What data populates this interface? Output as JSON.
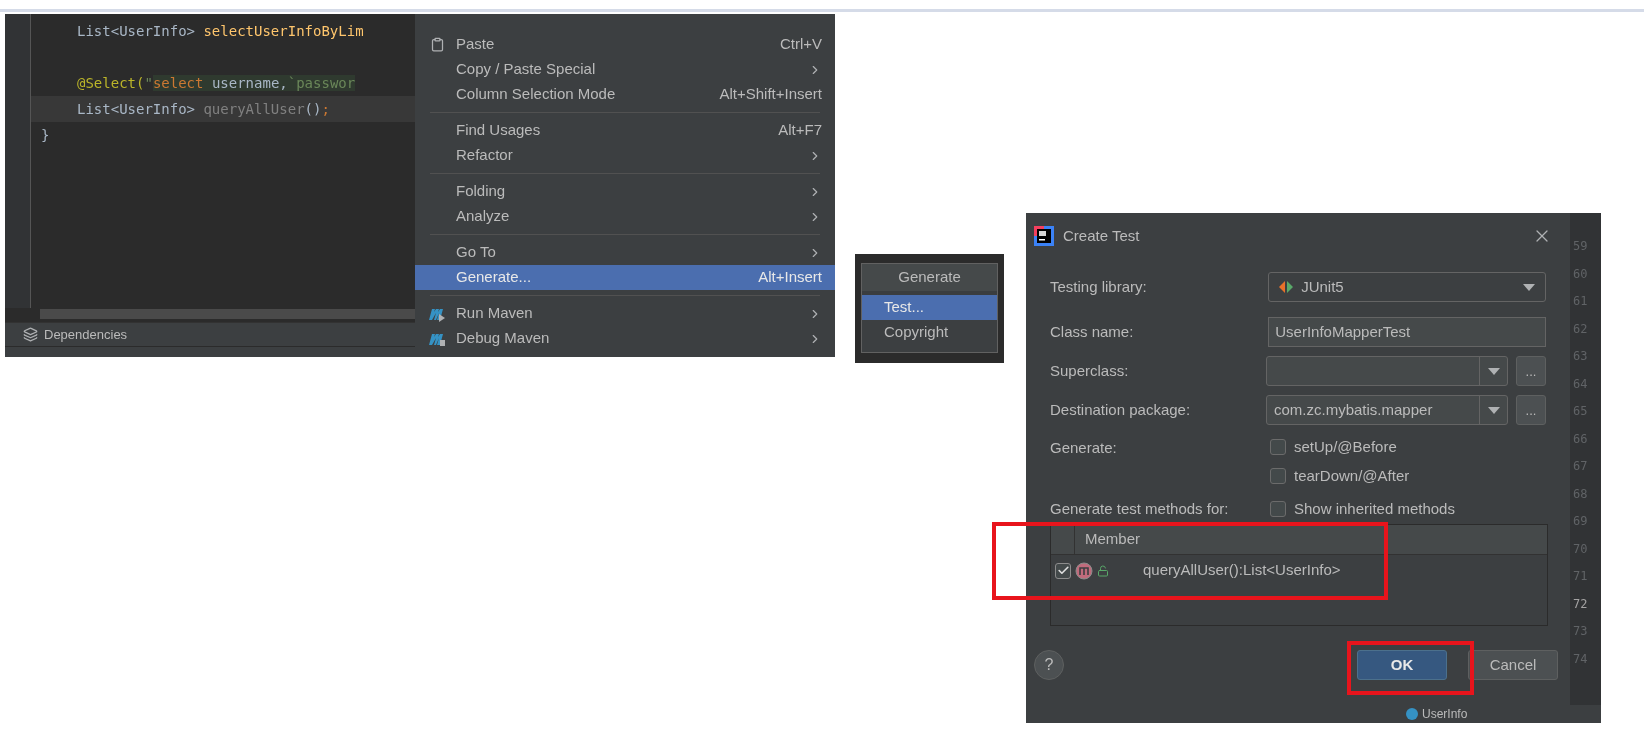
{
  "editor": {
    "lines": [
      {
        "kind": "code",
        "current": false,
        "indent": true,
        "tokens": [
          {
            "kind": "plain",
            "text": "List<UserInfo> "
          },
          {
            "kind": "method",
            "text": "selectUserInfoByLim"
          }
        ]
      },
      {
        "kind": "blank",
        "current": false
      },
      {
        "kind": "code",
        "current": false,
        "indent": true,
        "tokens": [
          {
            "kind": "annotation",
            "text": "@Select("
          },
          {
            "kind": "string",
            "text": "\""
          },
          {
            "kind": "sql_keyword",
            "text": "select"
          },
          {
            "kind": "sql_ident",
            "text": " username,"
          },
          {
            "kind": "sql_quoted",
            "text": "`passwor"
          }
        ]
      },
      {
        "kind": "code",
        "current": true,
        "indent": true,
        "tokens": [
          {
            "kind": "plain",
            "text": "List<UserInfo> "
          },
          {
            "kind": "unused",
            "text": "queryAllUser"
          },
          {
            "kind": "plain",
            "text": "()"
          },
          {
            "kind": "semicolon",
            "text": ";"
          }
        ]
      },
      {
        "kind": "code",
        "current": false,
        "indent": false,
        "tokens": [
          {
            "kind": "plain",
            "text": "}"
          }
        ]
      }
    ],
    "tool_window_tab": "Dependencies"
  },
  "context_menu": {
    "groups": [
      [
        {
          "label": "Paste",
          "shortcut": "Ctrl+V",
          "submenu": false,
          "selected": false
        },
        {
          "label": "Copy / Paste Special",
          "submenu": true,
          "selected": false
        },
        {
          "label": "Column Selection Mode",
          "shortcut": "Alt+Shift+Insert",
          "submenu": false,
          "selected": false
        }
      ],
      [
        {
          "label": "Find Usages",
          "shortcut": "Alt+F7",
          "submenu": false,
          "selected": false
        },
        {
          "label": "Refactor",
          "submenu": true,
          "selected": false
        }
      ],
      [
        {
          "label": "Folding",
          "submenu": true,
          "selected": false
        },
        {
          "label": "Analyze",
          "submenu": true,
          "selected": false
        }
      ],
      [
        {
          "label": "Go To",
          "submenu": true,
          "selected": false
        },
        {
          "label": "Generate...",
          "shortcut": "Alt+Insert",
          "submenu": false,
          "selected": true
        }
      ],
      [
        {
          "label": "Run Maven",
          "submenu": true,
          "selected": false
        },
        {
          "label": "Debug Maven",
          "submenu": true,
          "selected": false
        }
      ]
    ]
  },
  "generate_popup": {
    "title": "Generate",
    "items": [
      {
        "label": "Test...",
        "selected": true
      },
      {
        "label": "Copyright",
        "selected": false
      }
    ]
  },
  "dialog": {
    "title": "Create Test",
    "fields": [
      {
        "kind": "dropdown",
        "label": "Testing library:",
        "value": "JUnit5"
      },
      {
        "kind": "text",
        "label": "Class name:",
        "value": "UserInfoMapperTest"
      },
      {
        "kind": "combo",
        "label": "Superclass:",
        "button": "..."
      },
      {
        "kind": "combo",
        "label": "Destination package:",
        "value": "com.zc.mybatis.mapper",
        "button": "..."
      }
    ],
    "generate": {
      "label": "Generate:",
      "options": [
        {
          "label": "setUp/@Before",
          "checked": false
        },
        {
          "label": "tearDown/@After",
          "checked": false
        }
      ]
    },
    "methods": {
      "label": "Generate test methods for:",
      "show_inherited": {
        "label": "Show inherited methods",
        "checked": false
      },
      "column": "Member",
      "rows": [
        {
          "signature": "queryAllUser():List<UserInfo>",
          "checked": true
        }
      ]
    },
    "help": "?",
    "buttons": [
      {
        "label": "OK",
        "default": true
      },
      {
        "label": "Cancel",
        "default": false
      }
    ]
  },
  "gutter": [
    {
      "number": "59",
      "current": false
    },
    {
      "number": "60",
      "current": false
    },
    {
      "number": "61",
      "current": false
    },
    {
      "number": "62",
      "current": false
    },
    {
      "number": "63",
      "current": false
    },
    {
      "number": "64",
      "current": false
    },
    {
      "number": "65",
      "current": false
    },
    {
      "number": "66",
      "current": false
    },
    {
      "number": "67",
      "current": false
    },
    {
      "number": "68",
      "current": false
    },
    {
      "number": "69",
      "current": false
    },
    {
      "number": "70",
      "current": false
    },
    {
      "number": "71",
      "current": false
    },
    {
      "number": "72",
      "current": true
    },
    {
      "number": "73",
      "current": false
    },
    {
      "number": "74",
      "current": false
    }
  ],
  "below_dialog": "UserInfo"
}
